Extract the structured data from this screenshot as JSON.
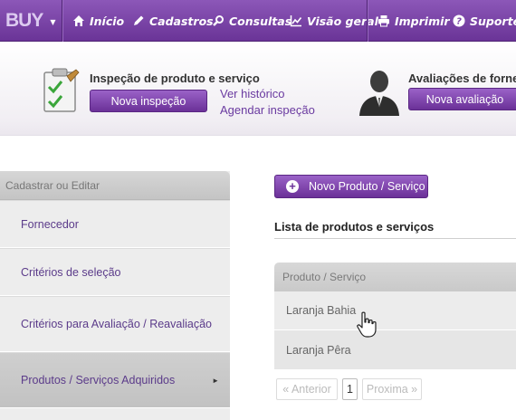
{
  "navbar": {
    "brand": "BUY",
    "items": [
      {
        "label": "Início",
        "icon": "home-icon"
      },
      {
        "label": "Cadastros",
        "icon": "pencil-icon"
      },
      {
        "label": "Consultas",
        "icon": "search-icon"
      },
      {
        "label": "Visão geral",
        "icon": "chart-icon"
      },
      {
        "label": "Imprimir",
        "icon": "printer-icon"
      },
      {
        "label": "Suporte",
        "icon": "help-icon"
      }
    ]
  },
  "header": {
    "inspection": {
      "title": "Inspeção de produto e serviço",
      "button": "Nova inspeção",
      "links": [
        "Ver histórico",
        "Agendar inspeção"
      ]
    },
    "evaluation": {
      "title": "Avaliações de forne",
      "button": "Nova avaliação"
    }
  },
  "sidebar": {
    "header": "Cadastrar ou Editar",
    "items": [
      {
        "label": "Fornecedor"
      },
      {
        "label": "Critérios de seleção"
      },
      {
        "label": "Critérios para Avaliação / Reavaliação"
      },
      {
        "label": "Produtos / Serviços Adquiridos",
        "active": true
      }
    ]
  },
  "main": {
    "new_button": "Novo Produto / Serviço",
    "list_title": "Lista de produtos e serviços",
    "table": {
      "header": "Produto / Serviço",
      "rows": [
        "Laranja Bahia",
        "Laranja Pêra"
      ]
    },
    "pagination": {
      "prev": "« Anterior",
      "current": "1",
      "next": "Proxima »"
    }
  },
  "colors": {
    "accent": "#7a44a8",
    "link": "#6a3aa0"
  }
}
